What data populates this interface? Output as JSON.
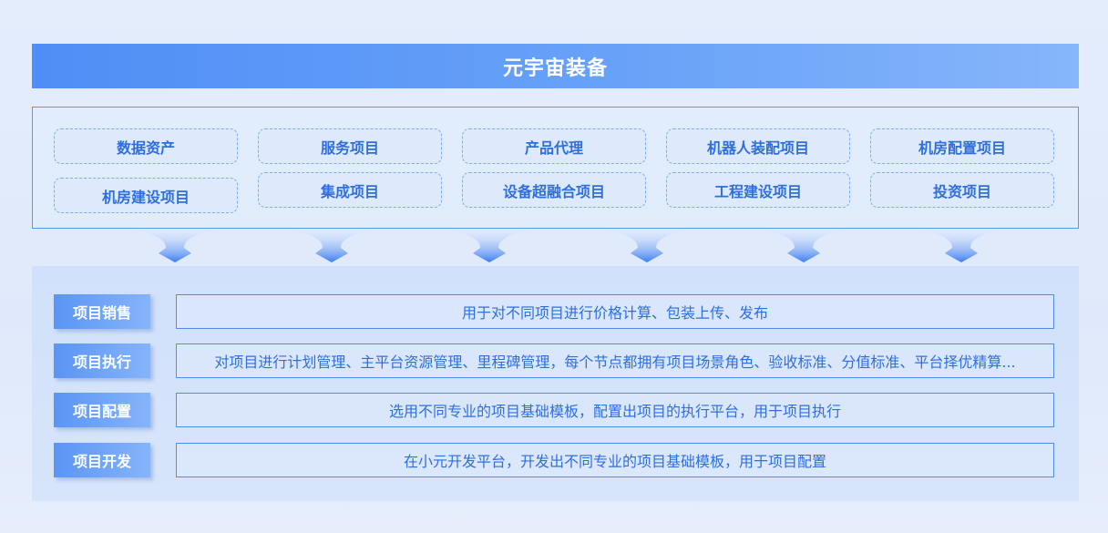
{
  "title": "元宇宙装备",
  "categories": {
    "col1": [
      "数据资产",
      "机房建设项目"
    ],
    "col2": [
      "服务项目",
      "集成项目"
    ],
    "col3": [
      "产品代理",
      "设备超融合项目"
    ],
    "col4": [
      "机器人装配项目",
      "工程建设项目"
    ],
    "col5": [
      "机房配置项目",
      "投资项目"
    ]
  },
  "rows": [
    {
      "label": "项目销售",
      "desc": "用于对不同项目进行价格计算、包装上传、发布"
    },
    {
      "label": "项目执行",
      "desc": "对项目进行计划管理、主平台资源管理、里程碑管理，每个节点都拥有项目场景角色、验收标准、分值标准、平台择优精算..."
    },
    {
      "label": "项目配置",
      "desc": "选用不同专业的项目基础模板，配置出项目的执行平台，用于项目执行"
    },
    {
      "label": "项目开发",
      "desc": "在小元开发平台，开发出不同专业的项目基础模板，用于项目配置"
    }
  ],
  "colors": {
    "accent": "#4f8ef6",
    "text_blue": "#2f6fdc",
    "border": "#5a97e6"
  }
}
